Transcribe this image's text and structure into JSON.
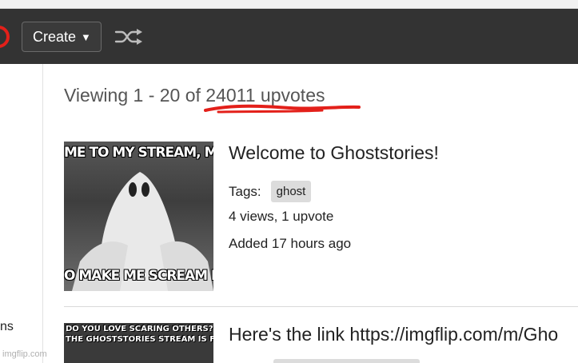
{
  "navbar": {
    "create_label": "Create",
    "create_caret": "▼",
    "shuffle_icon": "shuffle-icon",
    "logo_icon": "imgflip-logo",
    "bg_color": "#333333"
  },
  "header": {
    "viewing_text": "Viewing 1 - 20 of 24011 upvotes",
    "annotation_color": "#e3201a"
  },
  "sidebar": {
    "fragment_text": "ns"
  },
  "posts": [
    {
      "title": "Welcome to Ghoststories!",
      "tags_label": "Tags:",
      "tag": "ghost",
      "stats": "4 views, 1 upvote",
      "added": "Added 17 hours ago",
      "meme_top": "ME TO MY STREAM, MO",
      "meme_bottom": "O MAKE ME SCREAM IN"
    },
    {
      "title": "Here's the link https://imgflip.com/m/Gho",
      "meme_line1": "DO YOU LOVE SCARING OTHERS? IF",
      "meme_line2": "THE GHOSTSTORIES STREAM IS FOR"
    }
  ],
  "watermark": "imgflip.com"
}
